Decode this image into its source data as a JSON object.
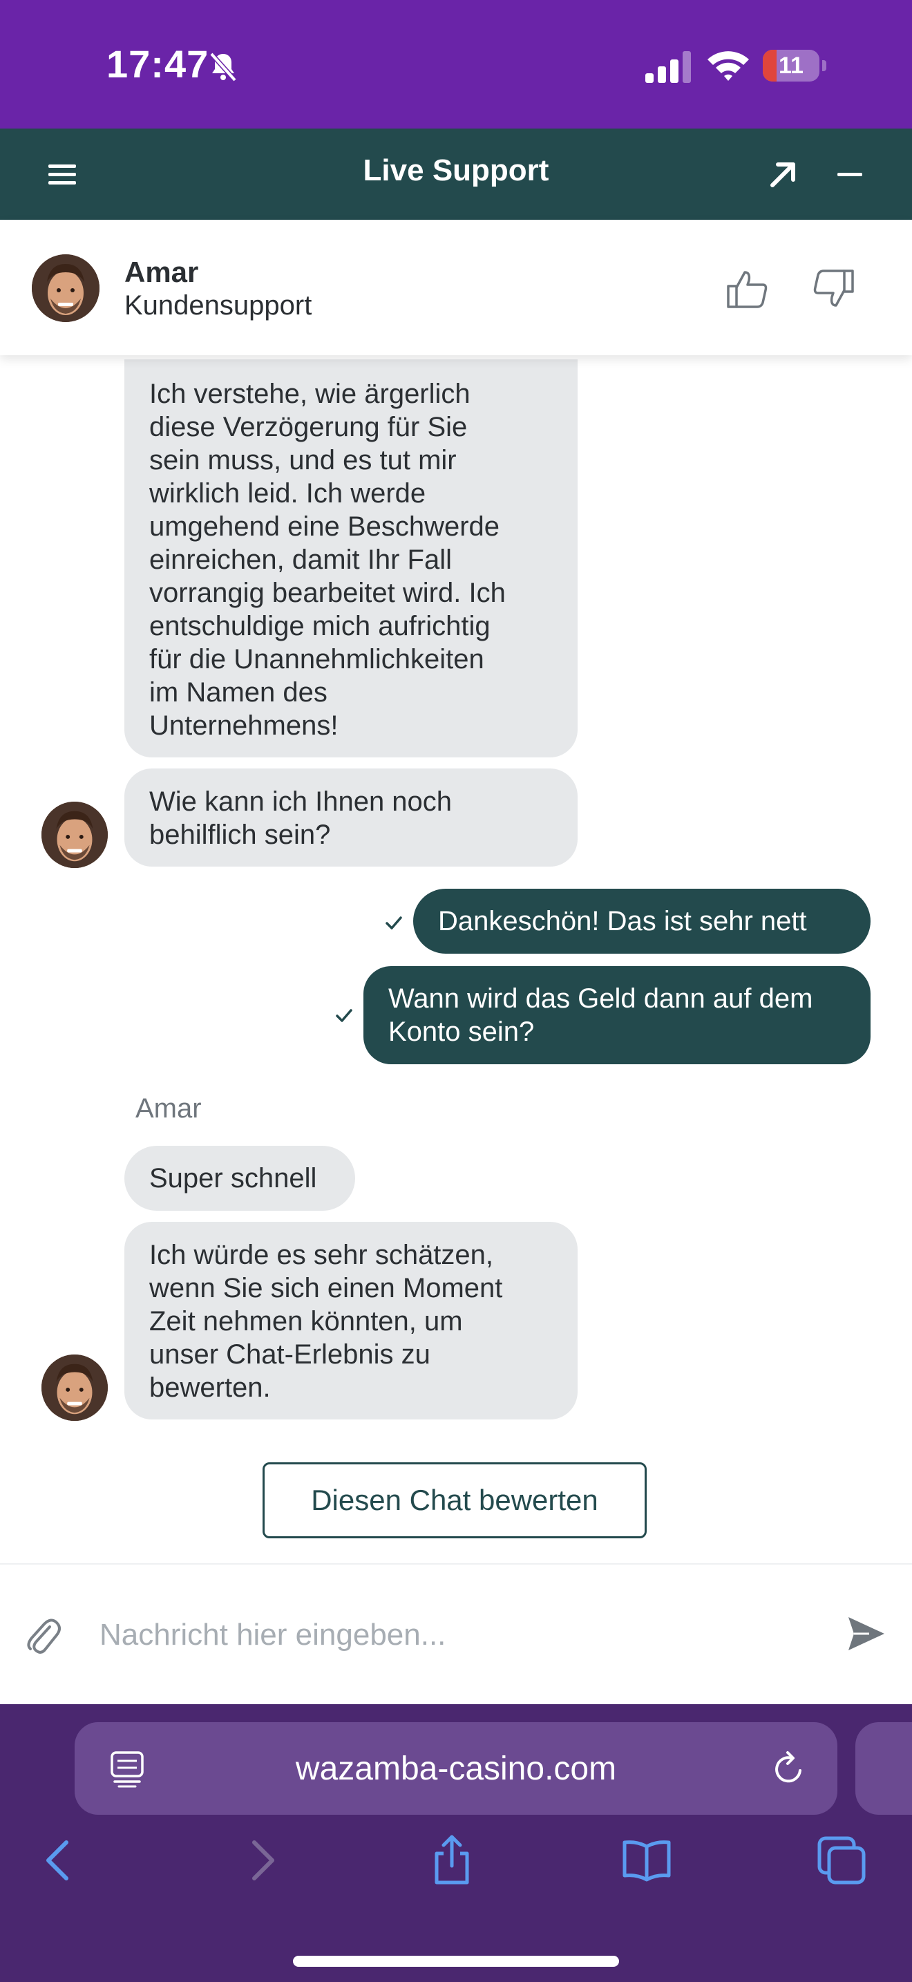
{
  "status_bar": {
    "time": "17:47",
    "battery_level": "11",
    "battery_fraction": 0.11,
    "icons": [
      "bell-slash-icon",
      "cellular-signal-icon",
      "wifi-icon",
      "battery-icon"
    ]
  },
  "header": {
    "title": "Live Support",
    "icons": [
      "hamburger-menu-icon",
      "expand-arrow-icon",
      "minimize-icon"
    ],
    "color": "#234a4d"
  },
  "agent": {
    "name": "Amar",
    "role": "Kundensupport",
    "icons": [
      "thumbs-up-icon",
      "thumbs-down-icon"
    ]
  },
  "messages": [
    {
      "from": "agent",
      "text": "Ich verstehe, wie ärgerlich\ndiese Verzögerung für Sie\nsein muss, und es tut mir\nwirklich leid. Ich werde\numgehend eine Beschwerde\neinreichen, damit Ihr Fall\nvorrangig bearbeitet wird. Ich\nentschuldige mich aufrichtig\nfür die Unannehmlichkeiten\nim Namen des\nUnternehmens!"
    },
    {
      "from": "agent",
      "text": "Wie kann ich Ihnen noch\nbehilflich sein?"
    },
    {
      "from": "user",
      "text": "Dankeschön! Das ist sehr nett",
      "status": "sent"
    },
    {
      "from": "user",
      "text": "Wann wird das Geld dann auf dem\nKonto sein?",
      "status": "sent"
    },
    {
      "from": "agent",
      "text": "Super schnell"
    },
    {
      "from": "agent",
      "text": "Ich würde es sehr schätzen,\nwenn Sie sich einen Moment\nZeit nehmen könnten, um\nunser Chat-Erlebnis zu\nbewerten."
    }
  ],
  "sender_label": "Amar",
  "rate_button": "Diesen Chat bewerten",
  "composer": {
    "placeholder": "Nachricht hier eingeben...",
    "icons": [
      "paperclip-icon",
      "send-icon"
    ]
  },
  "browser": {
    "url": "wazamba-casino.com",
    "icons": [
      "reader-mode-icon",
      "reload-icon",
      "back-icon",
      "forward-icon",
      "share-icon",
      "bookmarks-icon",
      "tabs-icon"
    ]
  },
  "colors": {
    "status_bar": "#6a24a8",
    "user_bubble": "#234a4d",
    "agent_bubble": "#e6e8ea",
    "browser_bar": "#4a276f"
  }
}
